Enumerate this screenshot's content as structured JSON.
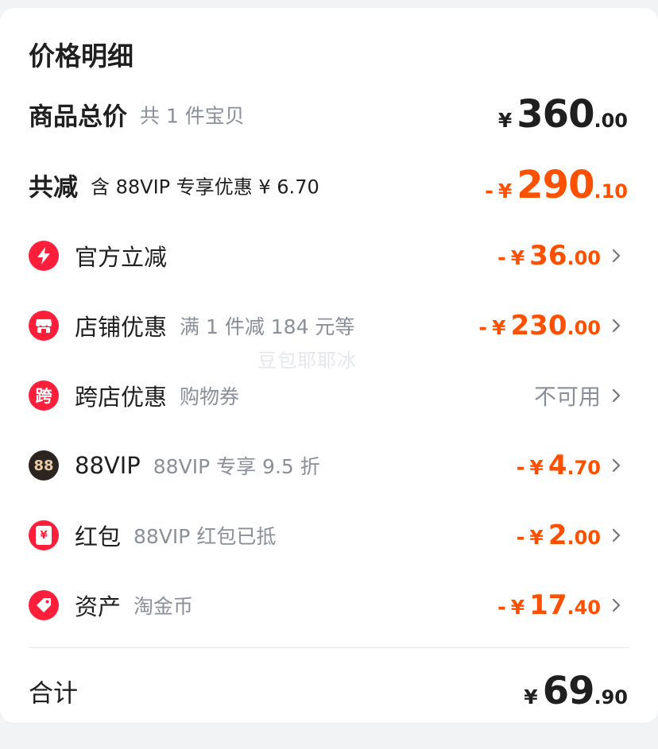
{
  "title": "价格明细",
  "watermark": "豆包耶耶冰",
  "total_goods": {
    "label": "商品总价",
    "sub": "共 1 件宝贝",
    "currency": "¥",
    "integer": "360",
    "decimal": ".00"
  },
  "total_reduce": {
    "label": "共减",
    "sub": "含 88VIP 专享优惠 ¥ 6.70",
    "sign": "-",
    "currency": "¥",
    "integer": "290",
    "decimal": ".10"
  },
  "items": [
    {
      "label": "官方立减",
      "sub": "",
      "sign": "-",
      "currency": "¥",
      "integer": "36",
      "decimal": ".00",
      "icon": "lightning-icon"
    },
    {
      "label": "店铺优惠",
      "sub": "满 1 件减 184 元等",
      "sign": "-",
      "currency": "¥",
      "integer": "230",
      "decimal": ".00",
      "icon": "shop-icon"
    },
    {
      "label": "跨店优惠",
      "sub": "购物券",
      "status": "不可用",
      "icon": "kua-icon",
      "icon_text": "跨"
    },
    {
      "label": "88VIP",
      "sub": "88VIP 专享 9.5 折",
      "sign": "-",
      "currency": "¥",
      "integer": "4",
      "decimal": ".70",
      "icon": "vip88-icon",
      "icon_text": "88"
    },
    {
      "label": "红包",
      "sub": "88VIP 红包已抵",
      "sign": "-",
      "currency": "¥",
      "integer": "2",
      "decimal": ".00",
      "icon": "red-packet-icon",
      "icon_text": "¥"
    },
    {
      "label": "资产",
      "sub": "淘金币",
      "sign": "-",
      "currency": "¥",
      "integer": "17",
      "decimal": ".40",
      "icon": "tag-icon"
    }
  ],
  "total": {
    "label": "合计",
    "currency": "¥",
    "integer": "69",
    "decimal": ".90"
  },
  "colors": {
    "accent_orange": "#ff5000",
    "icon_red": "#ff1f3b",
    "icon_dark": "#2b2420",
    "text_gray": "#8a8f99"
  }
}
